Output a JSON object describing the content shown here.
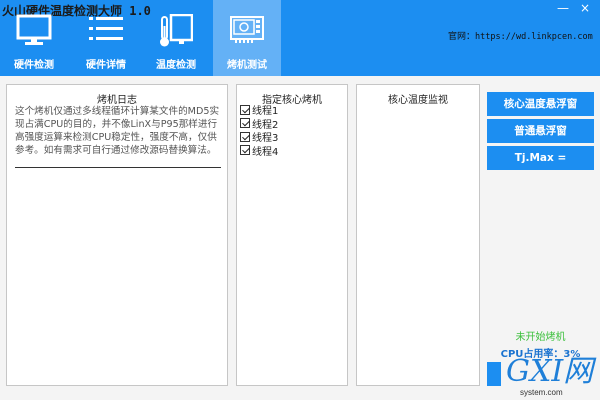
{
  "window": {
    "title": "火山硬件温度检测大师 1.0",
    "minimize": "—",
    "close": "×"
  },
  "header": {
    "site_label": "官网：",
    "site_url": "https://wd.linkpcen.com",
    "tabs": [
      {
        "label": "硬件检测",
        "icon": "monitor-icon"
      },
      {
        "label": "硬件详情",
        "icon": "list-icon"
      },
      {
        "label": "温度检测",
        "icon": "thermometer-monitor-icon"
      },
      {
        "label": "烤机测试",
        "icon": "graphics-card-icon"
      }
    ],
    "active_tab": 3
  },
  "log": {
    "title": "烤机日志",
    "text": "这个烤机仅通过多线程循环计算某文件的MD5实现占满CPU的目的，并不像LinX与P95那样进行高强度运算来检测CPU稳定性，强度不高，仅供参考。如有需求可自行通过修改源码替换算法。"
  },
  "cores": {
    "title": "指定核心烤机",
    "threads": [
      {
        "label": "线程1",
        "checked": true
      },
      {
        "label": "线程2",
        "checked": true
      },
      {
        "label": "线程3",
        "checked": true
      },
      {
        "label": "线程4",
        "checked": true
      }
    ]
  },
  "temp": {
    "title": "核心温度监视"
  },
  "buttons": {
    "core_float": "核心温度悬浮窗",
    "normal_float": "普通悬浮窗",
    "tjmax": "Tj.Max ="
  },
  "status": {
    "burn_state": "未开始烤机",
    "cpu_usage": "CPU占用率：3%"
  },
  "watermark": {
    "big": "GXI网",
    "small": "system.com"
  },
  "colors": {
    "header": "#1c8ef1",
    "active_tab": "#64b1f6",
    "status_green": "#3cc03c"
  }
}
